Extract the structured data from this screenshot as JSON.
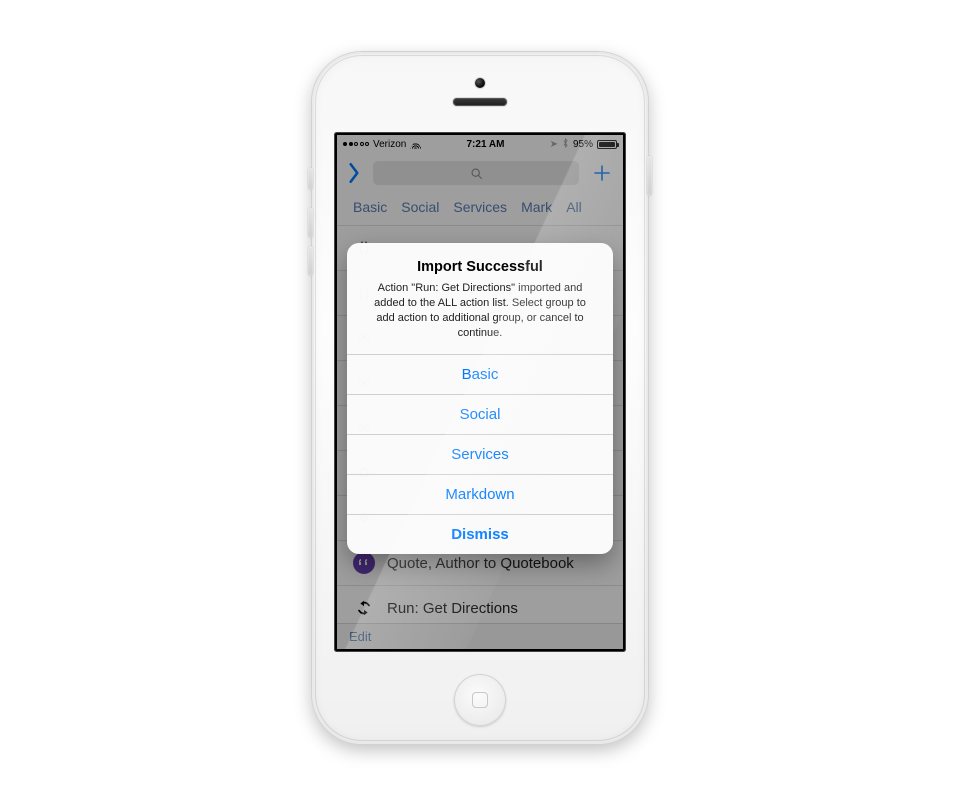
{
  "statusbar": {
    "carrier": "Verizon",
    "time": "7:21 AM",
    "battery_pct": "95%"
  },
  "navbar": {
    "search_placeholder": ""
  },
  "tabs": [
    "Basic",
    "Social",
    "Services",
    "Mark",
    "All"
  ],
  "bg_rows": {
    "quote": "Quote, Author to Quotebook",
    "run_dir": "Run: Get Directions"
  },
  "footer": {
    "edit": "Edit"
  },
  "alert": {
    "title": "Import Successful",
    "message": "Action \"Run: Get Directions\" imported and added to the ALL action list. Select group to add action to additional group, or cancel to continue.",
    "options": [
      "Basic",
      "Social",
      "Services",
      "Markdown"
    ],
    "dismiss": "Dismiss"
  },
  "colors": {
    "tint": "#007aff"
  }
}
